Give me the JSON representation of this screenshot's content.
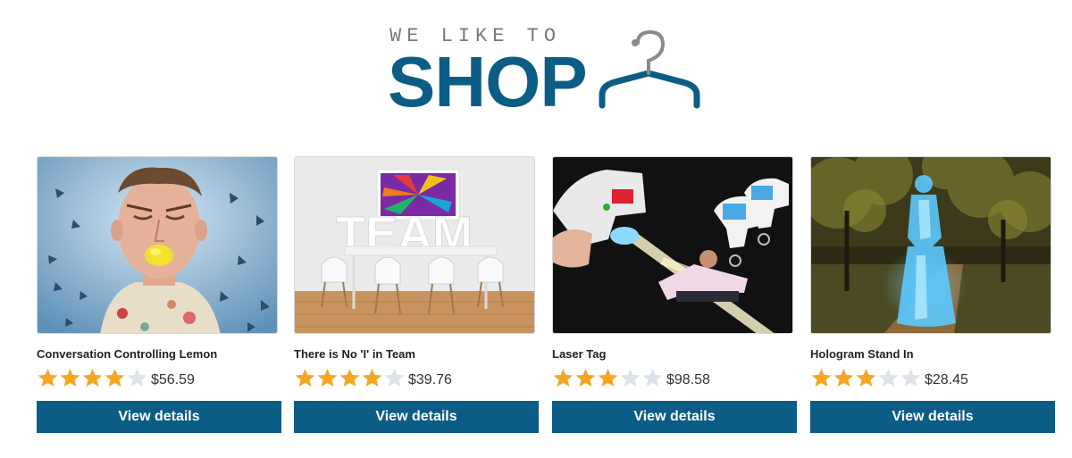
{
  "logo": {
    "tagline": "WE LIKE TO",
    "word": "SHOP",
    "icon": "hanger-icon",
    "color": "#0b5d86"
  },
  "products": [
    {
      "name": "Conversation Controlling Lemon",
      "rating": 4,
      "max_rating": 5,
      "price": "$56.59",
      "button": "View details",
      "image": "man-biting-lemon-image"
    },
    {
      "name": "There is No 'I' in Team",
      "rating": 4,
      "max_rating": 5,
      "price": "$39.76",
      "button": "View details",
      "image": "team-meeting-room-image"
    },
    {
      "name": "Laser Tag",
      "rating": 3,
      "max_rating": 5,
      "price": "$98.58",
      "button": "View details",
      "image": "laser-tag-guns-image"
    },
    {
      "name": "Hologram Stand In",
      "rating": 3,
      "max_rating": 5,
      "price": "$28.45",
      "button": "View details",
      "image": "hologram-woman-park-image"
    }
  ],
  "colors": {
    "button": "#0b5d86",
    "star_on": "#f5a623",
    "star_off": "#dde3e8"
  }
}
